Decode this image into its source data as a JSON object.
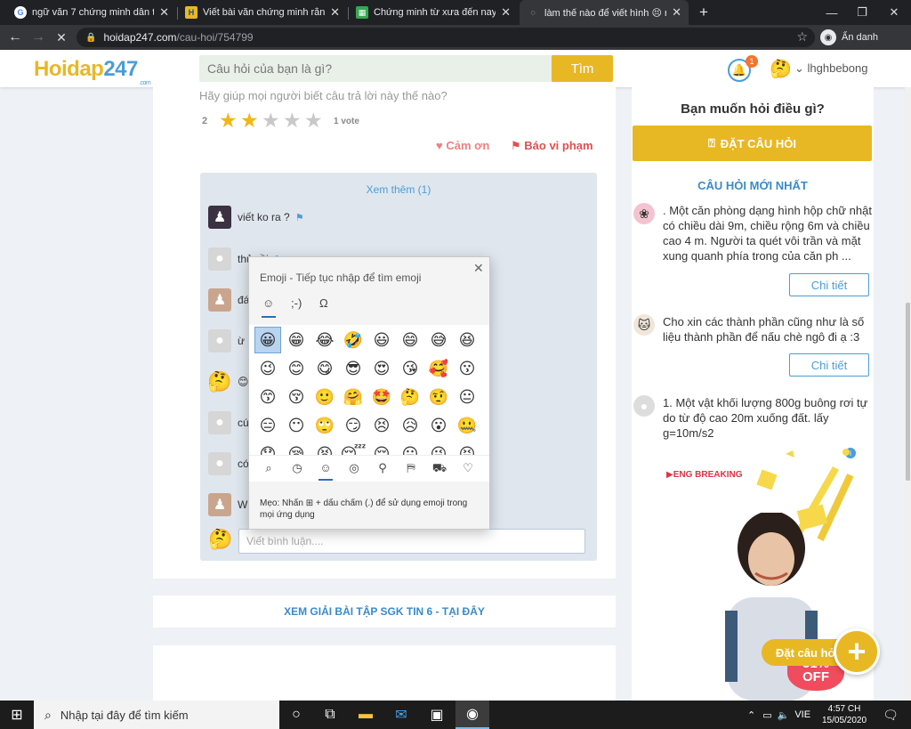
{
  "browser": {
    "tabs": [
      {
        "title": "ngữ văn 7 chứng minh dân tộc",
        "icon": "G",
        "iconbg": "#ffffff",
        "iconfg": "#4285f4"
      },
      {
        "title": "Viết bài văn chứng minh rằng nhân",
        "icon": "H",
        "iconbg": "#e8b824",
        "iconfg": "#1f4f7a"
      },
      {
        "title": "Chứng minh từ xưa đến nay ông",
        "icon": "▦",
        "iconbg": "#34a853",
        "iconfg": "#ffffff"
      },
      {
        "title": "làm thế nào để viết hình 😣 này",
        "icon": "◌",
        "iconbg": "transparent",
        "iconfg": "#e8eaed"
      }
    ],
    "new_tab": "+",
    "url_host": "hoidap247.com",
    "url_path": "/cau-hoi/754799",
    "profile": "Ẩn danh"
  },
  "site": {
    "logo_a": "Hoidap",
    "logo_b": "247",
    "logo_com": ".com",
    "search_placeholder": "Câu hỏi của bạn là gì?",
    "search_button": "Tìm",
    "notif_count": "1",
    "username": "lhghbebong"
  },
  "answer": {
    "help_text": "Hãy giúp mọi người biết câu trả lời này thế nào?",
    "rating_value": "2",
    "rating_stars": 2,
    "votes": "1 vote",
    "thanks": "Cảm ơn",
    "report": "Báo vi phạm"
  },
  "comments": {
    "see_more": "Xem thêm (1)",
    "items": [
      {
        "text": "viết ko ra ?",
        "flag": "⚑"
      },
      {
        "text": "thử rồi",
        "flag": "⚑"
      },
      {
        "text": "đá",
        "flag": ""
      },
      {
        "text": "ừ",
        "flag": ""
      },
      {
        "text": "😊",
        "flag": ""
      },
      {
        "text": "cú",
        "flag": ""
      },
      {
        "text": "có",
        "flag": ""
      },
      {
        "text": "W",
        "flag": ""
      }
    ],
    "input_placeholder": "Viết bình luận...."
  },
  "emoji_panel": {
    "title": "Emoji - Tiếp tục nhập để tìm emoji",
    "tabs": [
      "☺",
      ";-)",
      "Ω"
    ],
    "grid": [
      "😀",
      "😁",
      "😂",
      "🤣",
      "😃",
      "😄",
      "😅",
      "😆",
      "😉",
      "😊",
      "😋",
      "😎",
      "😍",
      "😘",
      "🥰",
      "😗",
      "😙",
      "😚",
      "🙂",
      "🤗",
      "🤩",
      "🤔",
      "🤨",
      "😐",
      "😑",
      "😶",
      "🙄",
      "😏",
      "😣",
      "😥",
      "😮",
      "🤐",
      "😯",
      "😪",
      "😫",
      "😴",
      "😌",
      "😛",
      "😜",
      "😝"
    ],
    "categories": [
      "⌕",
      "◷",
      "☺",
      "◎",
      "⚲",
      "⛿",
      "⛟",
      "♡"
    ],
    "tip": "Mẹo: Nhấn ⊞ + dấu chấm (.) để sử dụng emoji trong mọi ứng dụng"
  },
  "banner": {
    "sgk": "XEM GIẢI BÀI TẬP SGK TIN 6 - TẠI ĐÂY"
  },
  "sidebar": {
    "ask_title": "Bạn muốn hỏi điều gì?",
    "ask_button": "ĐẶT CÂU HỎI",
    "newest_title": "CÂU HỎI MỚI NHẤT",
    "questions": [
      {
        "text": ". Một căn phòng dạng hình hộp chữ nhật có chiều dài 9m, chiều rộng 6m và chiều cao 4 m. Người ta quét vôi trần và mặt xung quanh phía trong của căn ph ...",
        "button": "Chi tiết"
      },
      {
        "text": "Cho xin các thành phần cũng như là số liệu thành phần để nấu chè ngô đi ạ :3",
        "button": "Chi tiết"
      },
      {
        "text": "1. Một  vật khối lượng 800g buông rơi tự do từ độ cao 20m xuống đất. lấy g=10m/s2",
        "button": ""
      }
    ],
    "ad": {
      "tag": "ENG BREAKING",
      "badge": "51% OFF"
    },
    "fab_label": "Đặt câu hỏi",
    "fab_plus": "+"
  },
  "taskbar": {
    "search_placeholder": "Nhập tại đây để tìm kiếm",
    "lang": "VIE",
    "time": "4:57 CH",
    "date": "15/05/2020"
  },
  "colors": {
    "accent": "#e8b824",
    "link": "#4a9ed6",
    "danger": "#e05050"
  }
}
